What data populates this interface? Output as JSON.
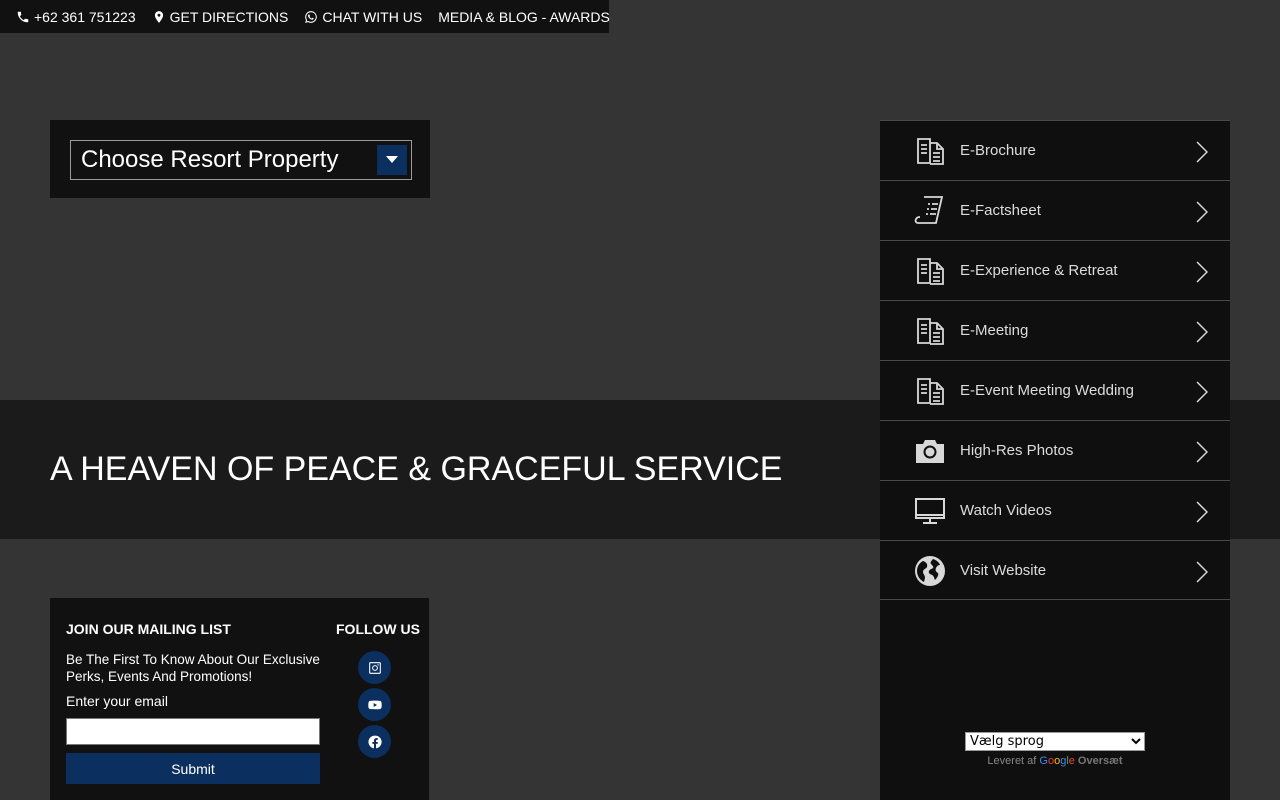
{
  "topbar": {
    "phone": "+62 361 751223",
    "directions": "GET DIRECTIONS",
    "chat": "CHAT WITH US",
    "media": "MEDIA & BLOG - AWARDS"
  },
  "resort_selector": {
    "placeholder": "Choose Resort Property"
  },
  "banner": {
    "title": "A HEAVEN OF PEACE & GRACEFUL SERVICE"
  },
  "side_menu": {
    "items": [
      {
        "label": "E-Brochure",
        "icon": "document-icon"
      },
      {
        "label": "E-Factsheet",
        "icon": "scroll-icon"
      },
      {
        "label": "E-Experience & Retreat",
        "icon": "document-icon"
      },
      {
        "label": "E-Meeting",
        "icon": "document-icon"
      },
      {
        "label": "E-Event Meeting Wedding",
        "icon": "document-icon"
      },
      {
        "label": "High-Res Photos",
        "icon": "camera-icon"
      },
      {
        "label": "Watch Videos",
        "icon": "monitor-icon"
      },
      {
        "label": "Visit Website",
        "icon": "globe-icon"
      }
    ]
  },
  "translate": {
    "selected": "Vælg sprog",
    "powered_by": "Leveret af",
    "google": "Google",
    "translate_label": "Oversæt"
  },
  "mailing": {
    "title": "JOIN OUR MAILING LIST",
    "subtitle": "Be The First To Know About Our Exclusive Perks, Events And Promotions!",
    "email_label": "Enter your email",
    "email_value": "",
    "submit": "Submit"
  },
  "follow": {
    "title": "FOLLOW US",
    "networks": [
      "instagram-icon",
      "youtube-icon",
      "facebook-icon"
    ]
  },
  "colors": {
    "background": "#343434",
    "panel": "#111111",
    "accent": "#0b2f5e"
  }
}
